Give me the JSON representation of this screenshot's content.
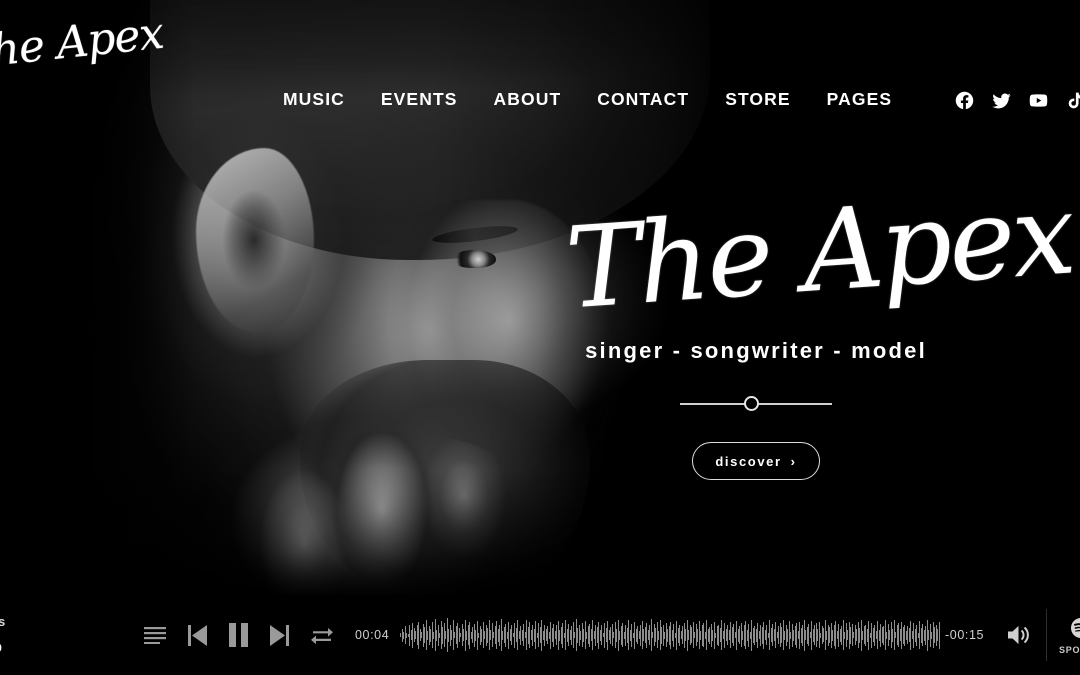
{
  "site": {
    "logo_text": "The Apex"
  },
  "nav": {
    "items": [
      {
        "label": "MUSIC"
      },
      {
        "label": "EVENTS"
      },
      {
        "label": "ABOUT"
      },
      {
        "label": "CONTACT"
      },
      {
        "label": "STORE"
      },
      {
        "label": "PAGES"
      }
    ]
  },
  "socials": [
    {
      "name": "facebook-icon"
    },
    {
      "name": "twitter-icon"
    },
    {
      "name": "youtube-icon"
    },
    {
      "name": "tiktok-icon"
    }
  ],
  "hero": {
    "title": "The Apex",
    "subtitle": "singer - songwriter - model",
    "cta_label": "discover",
    "cta_chevron": "›"
  },
  "player": {
    "track_label": "Tracks",
    "track_name": "tomb",
    "current_time": "00:04",
    "remaining_time": "-00:15",
    "controls": [
      {
        "name": "playlist-button"
      },
      {
        "name": "previous-track-button"
      },
      {
        "name": "pause-button"
      },
      {
        "name": "next-track-button"
      },
      {
        "name": "shuffle-button"
      }
    ],
    "volume_icon": "volume-icon",
    "spotify_label": "SPOTIFY",
    "waveform": [
      4,
      14,
      8,
      20,
      6,
      3,
      24,
      11,
      28,
      16,
      9,
      22,
      30,
      13,
      7,
      26,
      18,
      34,
      10,
      21,
      15,
      29,
      8,
      36,
      12,
      24,
      6,
      31,
      19,
      27,
      9,
      38,
      14,
      23,
      11,
      33,
      7,
      20,
      28,
      16,
      5,
      25,
      13,
      35,
      10,
      22,
      30,
      8,
      18,
      26,
      12,
      32,
      6,
      21,
      15,
      29,
      9,
      24,
      17,
      34,
      11,
      27,
      7,
      20,
      31,
      14,
      23,
      36,
      10,
      18,
      26,
      8,
      30,
      13,
      22,
      5,
      28,
      16,
      33,
      9,
      21,
      12,
      25,
      7,
      34,
      19,
      29,
      11,
      23,
      15,
      31,
      6,
      27,
      18,
      35,
      10,
      24,
      13,
      20,
      8,
      30,
      16,
      26,
      9,
      22,
      32,
      12,
      19,
      28,
      6,
      33,
      14,
      25,
      11,
      21,
      29,
      7,
      36,
      17,
      23,
      10,
      27,
      15,
      31,
      8,
      20,
      26,
      13,
      34,
      9,
      24,
      18,
      30,
      12,
      22,
      5,
      28,
      16,
      32,
      11,
      19,
      25,
      7,
      29,
      14,
      35,
      10,
      21,
      27,
      8,
      23,
      17,
      33,
      12,
      26,
      6,
      30,
      15,
      20,
      9,
      24,
      31,
      13,
      18,
      28,
      11,
      22,
      36,
      7,
      25,
      16,
      29,
      10,
      34,
      19,
      23,
      8,
      27,
      14,
      21,
      30,
      12,
      26,
      6,
      32,
      17,
      24,
      9,
      20,
      28,
      13,
      35,
      11,
      22,
      18,
      29,
      7,
      25,
      15,
      31,
      10,
      23,
      27,
      8,
      33,
      14,
      19,
      26,
      12,
      30,
      6,
      21,
      24,
      16,
      34,
      9,
      28,
      13,
      22,
      11,
      29,
      18,
      25,
      7,
      32,
      15,
      20,
      27,
      10,
      23,
      31,
      12,
      26,
      8,
      35,
      17,
      21,
      14,
      28,
      9,
      24,
      19,
      30,
      11,
      22,
      6,
      33,
      16,
      25,
      13,
      29,
      7,
      20,
      27,
      18,
      34,
      10,
      23,
      15,
      31,
      8,
      26,
      12,
      21,
      28,
      9,
      30,
      17,
      24,
      35,
      11,
      19,
      25,
      7,
      32,
      14,
      22,
      27,
      13,
      29,
      6,
      20,
      16,
      33,
      10,
      24,
      18,
      28,
      12,
      23,
      31,
      9,
      26,
      15,
      21,
      34,
      8,
      27,
      11,
      30,
      19,
      25,
      7,
      22,
      13,
      29,
      17,
      35,
      10,
      20,
      24,
      14,
      32,
      6,
      28,
      16,
      23,
      9,
      31,
      12,
      26,
      18,
      21,
      33,
      8,
      25,
      11,
      29,
      15,
      34,
      7,
      22,
      27,
      13,
      30,
      19,
      24,
      10,
      20,
      16,
      32,
      9,
      28,
      14,
      23,
      6,
      31,
      17,
      25,
      12,
      21,
      35,
      11,
      26,
      8,
      29,
      18,
      24,
      13,
      30
    ]
  }
}
